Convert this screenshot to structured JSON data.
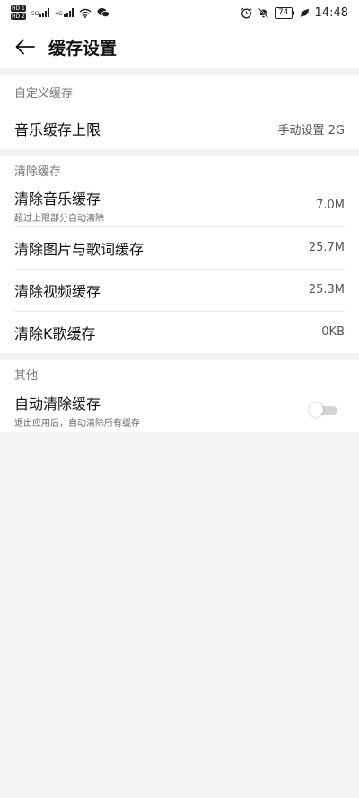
{
  "status_bar": {
    "hd_top": "HD 1",
    "hd_bottom": "HD 2",
    "net_1": "5G",
    "net_2": "4G",
    "battery": "74",
    "time": "14:48"
  },
  "header": {
    "title": "缓存设置"
  },
  "sections": [
    {
      "header": "自定义缓存",
      "items": [
        {
          "title": "音乐缓存上限",
          "value": "手动设置 2G"
        }
      ]
    },
    {
      "header": "清除缓存",
      "items": [
        {
          "title": "清除音乐缓存",
          "subtitle": "超过上限部分自动清除",
          "value": "7.0M"
        },
        {
          "title": "清除图片与歌词缓存",
          "value": "25.7M"
        },
        {
          "title": "清除视频缓存",
          "value": "25.3M"
        },
        {
          "title": "清除K歌缓存",
          "value": "0KB"
        }
      ]
    },
    {
      "header": "其他",
      "items": [
        {
          "title": "自动清除缓存",
          "subtitle": "退出应用后，自动清除所有缓存",
          "toggle": false
        }
      ]
    }
  ],
  "icons": {
    "back": "back-arrow-icon",
    "wifi": "wifi-icon",
    "wechat": "wechat-icon",
    "alarm": "alarm-icon",
    "mute": "bell-off-icon",
    "leaf": "leaf-icon"
  },
  "colors": {
    "background": "#f3f3f3",
    "card": "#ffffff",
    "toggle_off": "#d4d4d4"
  }
}
